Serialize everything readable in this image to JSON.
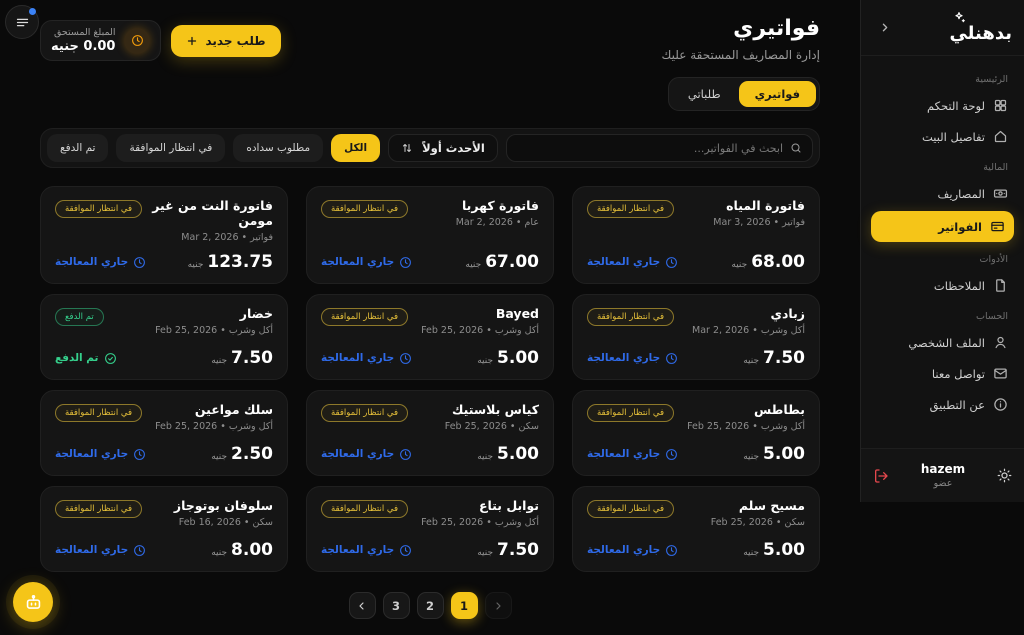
{
  "colors": {
    "accent": "#f5c518",
    "processing_blue": "#2f6ae8",
    "paid_green": "#35d08c",
    "logout_red": "#e5484d",
    "due_orange": "#f59e0b",
    "notification_blue": "#3b82f6"
  },
  "sidebar": {
    "logo_text": "بدهنلي",
    "sections": [
      {
        "label": "الرئيسية",
        "items": [
          {
            "icon": "dashboard-grid",
            "label": "لوحة التحكم"
          },
          {
            "icon": "home",
            "label": "تفاصيل البيت"
          }
        ]
      },
      {
        "label": "المالية",
        "items": [
          {
            "icon": "banknote",
            "label": "المصاريف"
          },
          {
            "icon": "credit-card",
            "label": "الفواتير",
            "active": true
          }
        ]
      },
      {
        "label": "الأدوات",
        "items": [
          {
            "icon": "note-file",
            "label": "الملاحظات"
          }
        ]
      },
      {
        "label": "الحساب",
        "items": [
          {
            "icon": "user",
            "label": "الملف الشخصي"
          },
          {
            "icon": "mail",
            "label": "تواصل معنا"
          },
          {
            "icon": "info",
            "label": "عن التطبيق"
          }
        ]
      }
    ],
    "user": {
      "name": "hazem",
      "role": "عضو"
    }
  },
  "header": {
    "title": "فواتيري",
    "subtitle": "إدارة المصاريف المستحقة عليك",
    "due_label": "المبلغ المستحق",
    "due_value": "0.00 جنيه",
    "new_request_label": "طلب جديد"
  },
  "tabs": [
    {
      "label": "فواتيري",
      "active": true
    },
    {
      "label": "طلباتي",
      "active": false
    }
  ],
  "filters": {
    "search_placeholder": "ابحث في الفواتير...",
    "sort_label": "الأحدث أولاً",
    "chips": [
      {
        "label": "الكل",
        "active": true
      },
      {
        "label": "مطلوب سداده",
        "active": false
      },
      {
        "label": "في انتظار الموافقة",
        "active": false
      },
      {
        "label": "تم الدفع",
        "active": false
      }
    ]
  },
  "cards": [
    {
      "title": "فاتورة المياه",
      "meta": "فواتير • Mar 3, 2026",
      "amount": "68.00",
      "currency": "جنيه",
      "badge": "في انتظار الموافقة",
      "status": "جاري المعالجة",
      "state": "pending"
    },
    {
      "title": "فاتورة كهربا",
      "meta": "عام • Mar 2, 2026",
      "amount": "67.00",
      "currency": "جنيه",
      "badge": "في انتظار الموافقة",
      "status": "جاري المعالجة",
      "state": "pending"
    },
    {
      "title": "فاتورة النت من غير مومن",
      "meta": "فواتير • Mar 2, 2026",
      "amount": "123.75",
      "currency": "جنيه",
      "badge": "في انتظار الموافقة",
      "status": "جاري المعالجة",
      "state": "pending"
    },
    {
      "title": "زبادي",
      "meta": "أكل وشرب • Mar 2, 2026",
      "amount": "7.50",
      "currency": "جنيه",
      "badge": "في انتظار الموافقة",
      "status": "جاري المعالجة",
      "state": "pending"
    },
    {
      "title": "Bayed",
      "meta": "أكل وشرب • Feb 25, 2026",
      "amount": "5.00",
      "currency": "جنيه",
      "badge": "في انتظار الموافقة",
      "status": "جاري المعالجة",
      "state": "pending"
    },
    {
      "title": "خضار",
      "meta": "أكل وشرب • Feb 25, 2026",
      "amount": "7.50",
      "currency": "جنيه",
      "badge": "تم الدفع",
      "status": "تم الدفع",
      "state": "paid"
    },
    {
      "title": "بطاطس",
      "meta": "أكل وشرب • Feb 25, 2026",
      "amount": "5.00",
      "currency": "جنيه",
      "badge": "في انتظار الموافقة",
      "status": "جاري المعالجة",
      "state": "pending"
    },
    {
      "title": "كياس بلاستيك",
      "meta": "سكن • Feb 25, 2026",
      "amount": "5.00",
      "currency": "جنيه",
      "badge": "في انتظار الموافقة",
      "status": "جاري المعالجة",
      "state": "pending"
    },
    {
      "title": "سلك مواعين",
      "meta": "أكل وشرب • Feb 25, 2026",
      "amount": "2.50",
      "currency": "جنيه",
      "badge": "في انتظار الموافقة",
      "status": "جاري المعالجة",
      "state": "pending"
    },
    {
      "title": "مسيح سلم",
      "meta": "سكن • Feb 25, 2026",
      "amount": "5.00",
      "currency": "جنيه",
      "badge": "في انتظار الموافقة",
      "status": "جاري المعالجة",
      "state": "pending"
    },
    {
      "title": "توابل بتاع",
      "meta": "أكل وشرب • Feb 25, 2026",
      "amount": "7.50",
      "currency": "جنيه",
      "badge": "في انتظار الموافقة",
      "status": "جاري المعالجة",
      "state": "pending"
    },
    {
      "title": "سلوفان بوتوجاز",
      "meta": "سكن • Feb 16, 2026",
      "amount": "8.00",
      "currency": "جنيه",
      "badge": "في انتظار الموافقة",
      "status": "جاري المعالجة",
      "state": "pending"
    }
  ],
  "pagination": {
    "pages": [
      "1",
      "2",
      "3"
    ],
    "active_page": "1"
  }
}
